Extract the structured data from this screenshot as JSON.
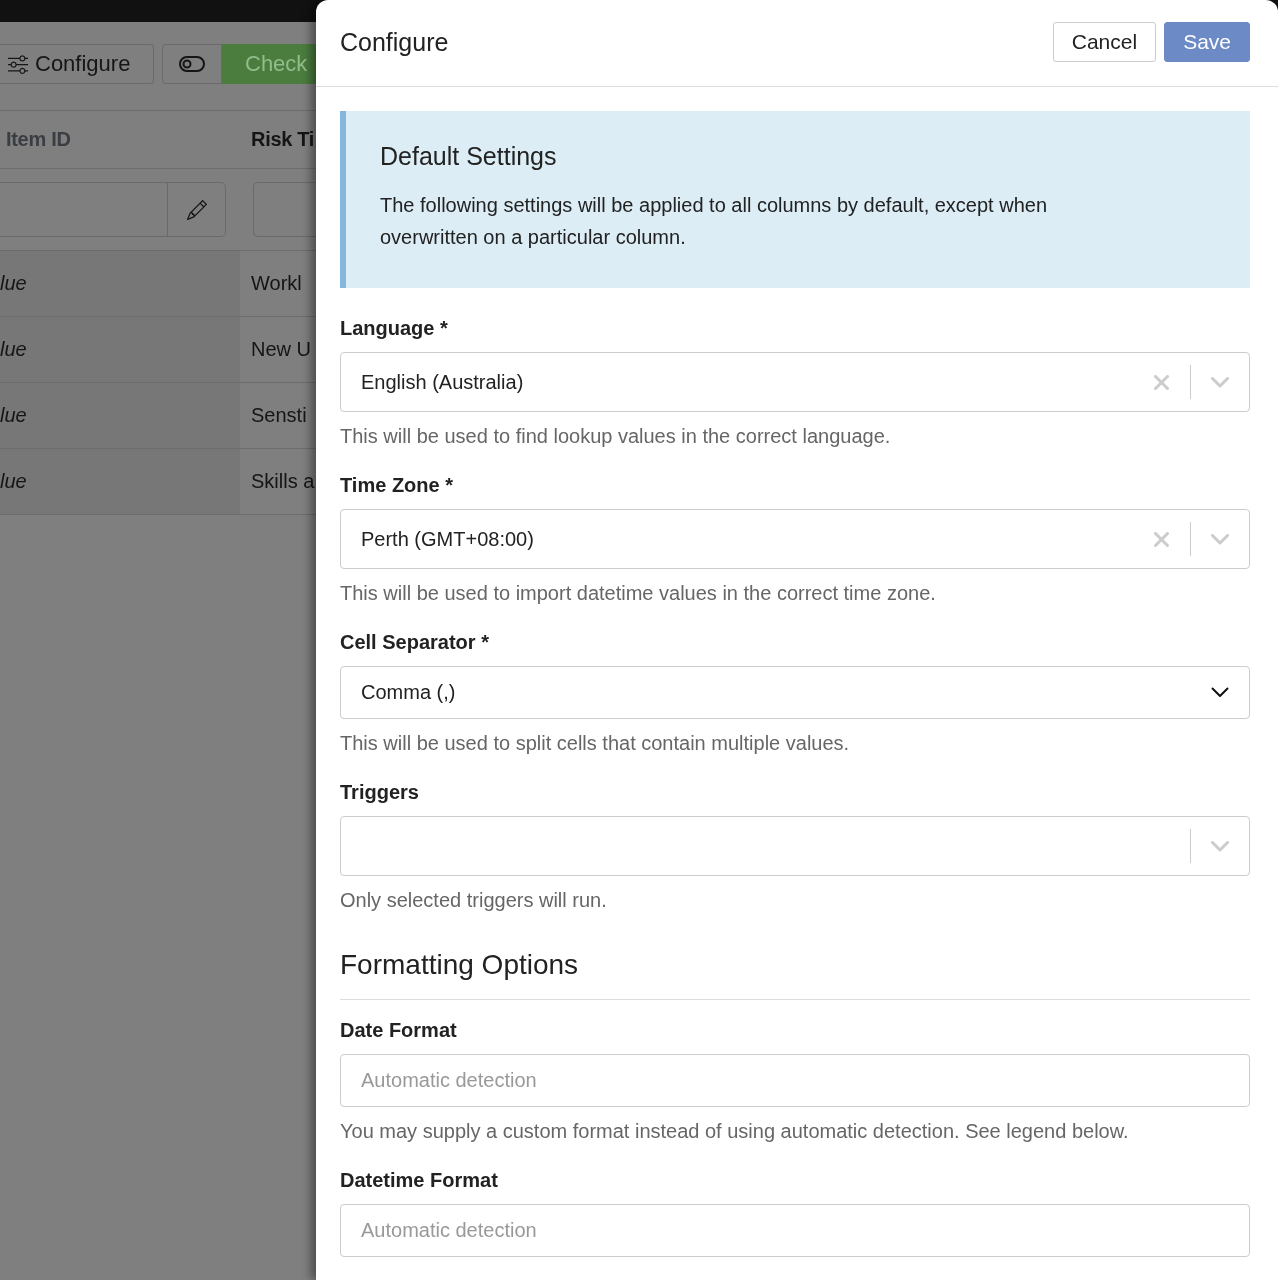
{
  "page": {
    "toolbar": [
      {
        "kind": "configure",
        "label": "Configure"
      },
      {
        "kind": "toggle"
      },
      {
        "kind": "check",
        "label": "Check"
      }
    ],
    "table": {
      "columns": [
        {
          "label": "Item ID",
          "readonly": true
        },
        {
          "label": "Risk Ti",
          "readonly": false
        }
      ],
      "filters": [
        {
          "kind": "edit"
        },
        {
          "kind": "plain"
        }
      ],
      "rows": [
        {
          "cells": [
            "lue",
            "Workl"
          ]
        },
        {
          "cells": [
            "lue",
            "New U"
          ]
        },
        {
          "cells": [
            "lue",
            "Sensti"
          ]
        },
        {
          "cells": [
            "lue",
            "Skills a"
          ]
        }
      ]
    }
  },
  "dialog": {
    "title": "Configure",
    "actions": [
      {
        "kind": "secondary",
        "label": "Cancel"
      },
      {
        "kind": "primary",
        "label": "Save"
      }
    ],
    "notice": {
      "title": "Default Settings",
      "text": "The following settings will be applied to all columns by default, except when overwritten on a particular column."
    },
    "fields": [
      {
        "kind": "select",
        "label": "Language *",
        "value": "English (Australia)",
        "clearable": true,
        "help": "This will be used to find lookup values in the correct language."
      },
      {
        "kind": "select",
        "label": "Time Zone *",
        "value": "Perth (GMT+08:00)",
        "clearable": true,
        "help": "This will be used to import datetime values in the correct time zone."
      },
      {
        "kind": "native_select",
        "label": "Cell Separator *",
        "value": "Comma (,)",
        "help": "This will be used to split cells that contain multiple values."
      },
      {
        "kind": "select",
        "label": "Triggers",
        "clearable": false,
        "help": "Only selected triggers will run."
      }
    ],
    "sections": [
      {
        "title": "Formatting Options",
        "fields": [
          {
            "kind": "text",
            "label": "Date Format",
            "placeholder": "Automatic detection",
            "help": "You may supply a custom format instead of using automatic detection. See legend below."
          },
          {
            "kind": "text",
            "label": "Datetime Format",
            "placeholder": "Automatic detection"
          }
        ]
      }
    ]
  }
}
